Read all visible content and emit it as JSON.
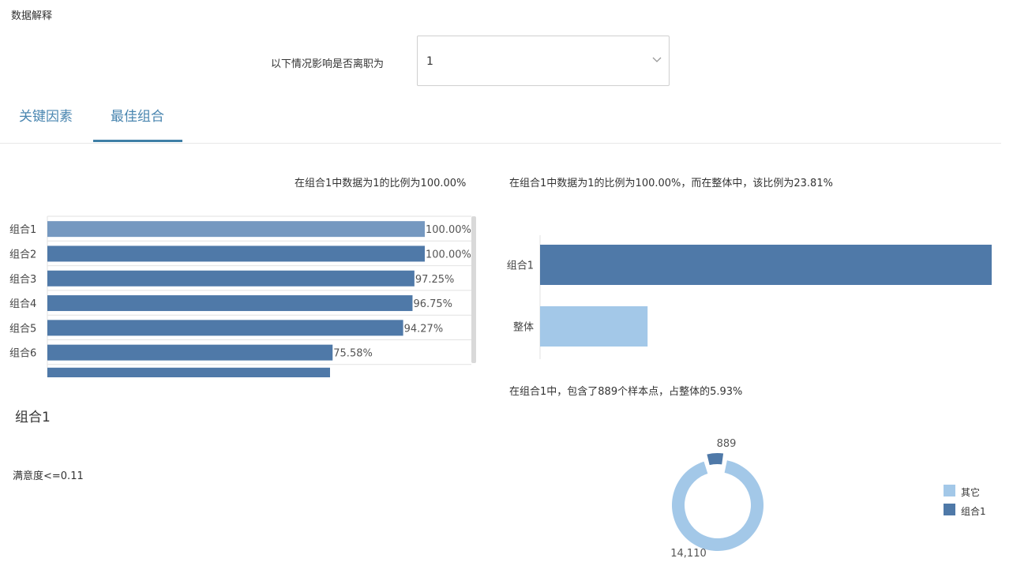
{
  "page_title": "数据解释",
  "filter": {
    "label": "以下情况影响是否离职为",
    "value": "1"
  },
  "tabs": [
    {
      "label": "关键因素"
    },
    {
      "label": "最佳组合"
    }
  ],
  "active_tab": "最佳组合",
  "colors": {
    "bar": "#4f79a8",
    "bar_highlight": "#7598c0",
    "light": "#a3c8e8",
    "accent": "#3f7fa6"
  },
  "left_caption": "在组合1中数据为1的比例为100.00%",
  "right_caption": "在组合1中数据为1的比例为100.00%，而在整体中，该比例为23.81%",
  "donut_caption": "在组合1中，包含了889个样本点，占整体的5.93%",
  "combo_title": "组合1",
  "combo_condition": "满意度<=0.11",
  "chart_data": [
    {
      "type": "bar",
      "orientation": "horizontal",
      "categories": [
        "组合1",
        "组合2",
        "组合3",
        "组合4",
        "组合5",
        "组合6"
      ],
      "values": [
        100.0,
        100.0,
        97.25,
        96.75,
        94.27,
        75.58
      ],
      "value_labels": [
        "100.00%",
        "100.00%",
        "97.25%",
        "96.75%",
        "94.27%",
        "75.58%"
      ],
      "xlim": [
        0,
        100
      ],
      "grid": true
    },
    {
      "type": "bar",
      "orientation": "horizontal",
      "categories": [
        "组合1",
        "整体"
      ],
      "values": [
        100.0,
        23.81
      ],
      "xlim": [
        0,
        100
      ]
    },
    {
      "type": "pie",
      "variant": "donut",
      "categories": [
        "其它",
        "组合1"
      ],
      "values": [
        14110,
        889
      ],
      "value_labels": [
        "14,110",
        "889"
      ],
      "legend": "right"
    }
  ]
}
